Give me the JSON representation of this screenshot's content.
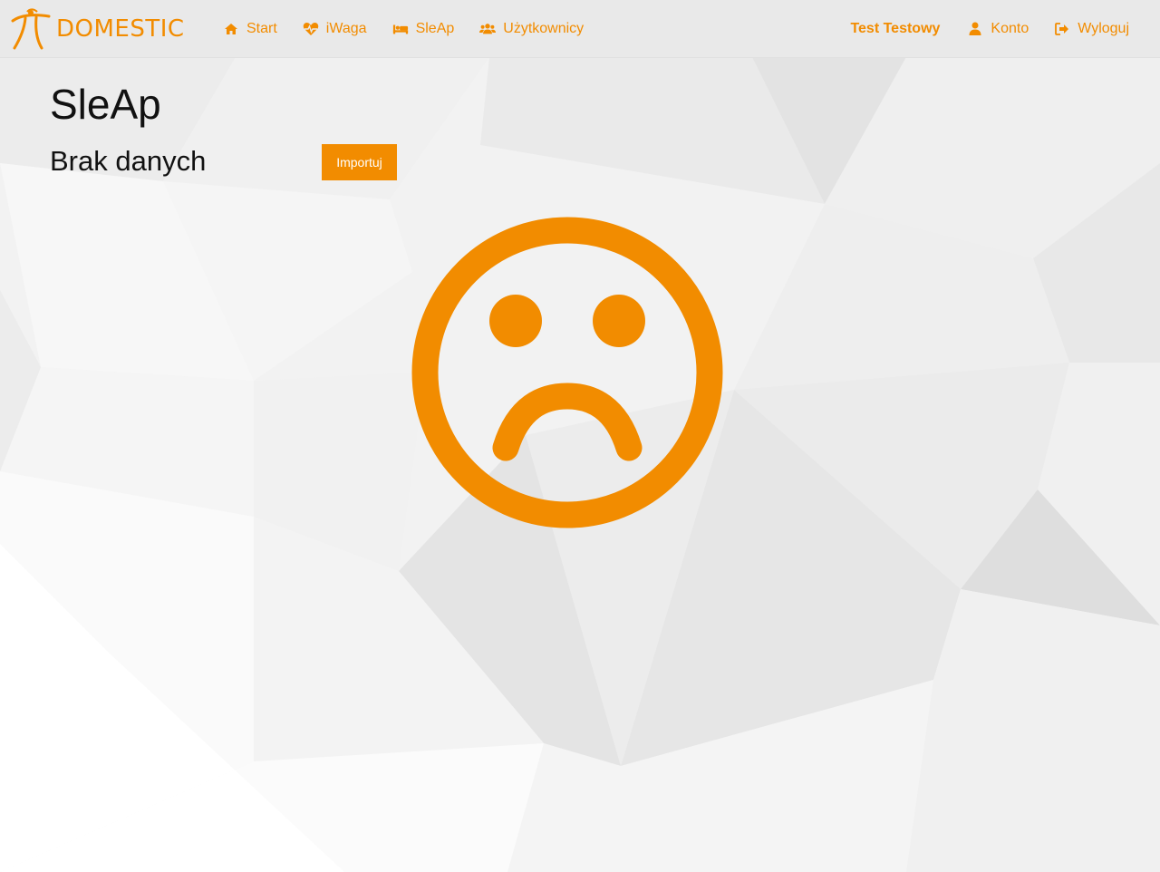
{
  "brand": {
    "name": "DOMESTIC",
    "color": "#f28c00"
  },
  "nav": {
    "left": [
      {
        "label": "Start",
        "icon": "home-icon"
      },
      {
        "label": "iWaga",
        "icon": "heartbeat-icon"
      },
      {
        "label": "SleAp",
        "icon": "bed-icon"
      },
      {
        "label": "Użytkownicy",
        "icon": "users-icon"
      }
    ],
    "user_name": "Test Testowy",
    "right": [
      {
        "label": "Konto",
        "icon": "user-icon"
      },
      {
        "label": "Wyloguj",
        "icon": "sign-out-icon"
      }
    ]
  },
  "main": {
    "title": "SleAp",
    "status": "Brak danych",
    "import_label": "Importuj",
    "empty_state_icon": "sad-face-icon"
  },
  "colors": {
    "accent": "#f28c00",
    "navbar_bg": "#e9e9e9",
    "text": "#111111"
  }
}
